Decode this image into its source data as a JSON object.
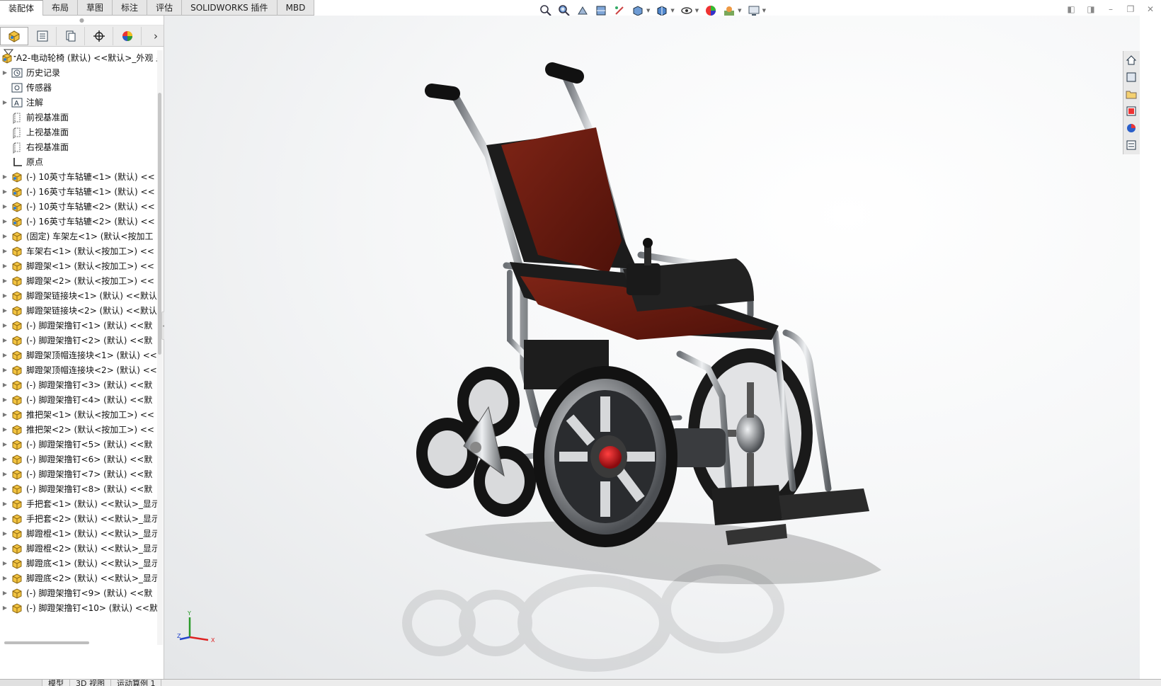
{
  "command_tabs": [
    {
      "label": "装配体"
    },
    {
      "label": "布局"
    },
    {
      "label": "草图"
    },
    {
      "label": "标注"
    },
    {
      "label": "评估"
    },
    {
      "label": "SOLIDWORKS 插件"
    },
    {
      "label": "MBD"
    }
  ],
  "view_toolbar": {
    "icons": [
      "zoom-to-fit-icon",
      "zoom-to-area-icon",
      "previous-view-icon",
      "section-view-icon",
      "dynamic-annotation-icon",
      "view-orientation-icon",
      "display-style-icon",
      "hide-show-items-icon",
      "edit-appearance-icon",
      "apply-scene-icon",
      "view-settings-icon"
    ]
  },
  "feature_tree": {
    "root_label": "A2-电动轮椅 (默认) <<默认>_外观 显",
    "items": [
      {
        "label": "历史记录",
        "icon": "history-icon",
        "expandable": true
      },
      {
        "label": "传感器",
        "icon": "sensor-icon",
        "expandable": false
      },
      {
        "label": "注解",
        "icon": "annotation-icon",
        "expandable": true
      },
      {
        "label": "前视基准面",
        "icon": "plane-icon",
        "expandable": false
      },
      {
        "label": "上视基准面",
        "icon": "plane-icon",
        "expandable": false
      },
      {
        "label": "右视基准面",
        "icon": "plane-icon",
        "expandable": false
      },
      {
        "label": "原点",
        "icon": "origin-icon",
        "expandable": false
      },
      {
        "label": "(-) 10英寸车轱辘<1> (默认) <<",
        "icon": "subassembly-icon",
        "expandable": true
      },
      {
        "label": "(-) 16英寸车轱辘<1> (默认) <<",
        "icon": "subassembly-icon",
        "expandable": true
      },
      {
        "label": "(-) 10英寸车轱辘<2> (默认) <<",
        "icon": "subassembly-icon",
        "expandable": true
      },
      {
        "label": "(-) 16英寸车轱辘<2> (默认) <<",
        "icon": "subassembly-icon",
        "expandable": true
      },
      {
        "label": "(固定) 车架左<1> (默认<按加工",
        "icon": "part-icon",
        "expandable": true
      },
      {
        "label": "车架右<1> (默认<按加工>) <<",
        "icon": "part-icon",
        "expandable": true
      },
      {
        "label": "脚蹬架<1> (默认<按加工>) <<",
        "icon": "part-icon",
        "expandable": true
      },
      {
        "label": "脚蹬架<2> (默认<按加工>) <<",
        "icon": "part-icon",
        "expandable": true
      },
      {
        "label": "脚蹬架链接块<1> (默认) <<默认",
        "icon": "part-icon",
        "expandable": true
      },
      {
        "label": "脚蹬架链接块<2> (默认) <<默认",
        "icon": "part-icon",
        "expandable": true
      },
      {
        "label": "(-) 脚蹬架撸钉<1> (默认) <<默",
        "icon": "part-icon",
        "expandable": true
      },
      {
        "label": "(-) 脚蹬架撸钉<2> (默认) <<默",
        "icon": "part-icon",
        "expandable": true
      },
      {
        "label": "脚蹬架顶帽连接块<1> (默认) <<",
        "icon": "part-icon",
        "expandable": true
      },
      {
        "label": "脚蹬架顶帽连接块<2> (默认) <<",
        "icon": "part-icon",
        "expandable": true
      },
      {
        "label": "(-) 脚蹬架撸钉<3> (默认) <<默",
        "icon": "part-icon",
        "expandable": true
      },
      {
        "label": "(-) 脚蹬架撸钉<4> (默认) <<默",
        "icon": "part-icon",
        "expandable": true
      },
      {
        "label": "推把架<1> (默认<按加工>) <<",
        "icon": "part-icon",
        "expandable": true
      },
      {
        "label": "推把架<2> (默认<按加工>) <<",
        "icon": "part-icon",
        "expandable": true
      },
      {
        "label": "(-) 脚蹬架撸钉<5> (默认) <<默",
        "icon": "part-icon",
        "expandable": true
      },
      {
        "label": "(-) 脚蹬架撸钉<6> (默认) <<默",
        "icon": "part-icon",
        "expandable": true
      },
      {
        "label": "(-) 脚蹬架撸钉<7> (默认) <<默",
        "icon": "part-icon",
        "expandable": true
      },
      {
        "label": "(-) 脚蹬架撸钉<8> (默认) <<默",
        "icon": "part-icon",
        "expandable": true
      },
      {
        "label": "手把套<1> (默认) <<默认>_显示",
        "icon": "part-icon",
        "expandable": true
      },
      {
        "label": "手把套<2> (默认) <<默认>_显示",
        "icon": "part-icon",
        "expandable": true
      },
      {
        "label": "脚蹬棍<1> (默认) <<默认>_显示",
        "icon": "part-icon",
        "expandable": true
      },
      {
        "label": "脚蹬棍<2> (默认) <<默认>_显示",
        "icon": "part-icon",
        "expandable": true
      },
      {
        "label": "脚蹬底<1> (默认) <<默认>_显示",
        "icon": "part-icon",
        "expandable": true
      },
      {
        "label": "脚蹬底<2> (默认) <<默认>_显示",
        "icon": "part-icon",
        "expandable": true
      },
      {
        "label": "(-) 脚蹬架撸钉<9> (默认) <<默",
        "icon": "part-icon",
        "expandable": true
      },
      {
        "label": "(-) 脚蹬架撸钉<10> (默认) <<默",
        "icon": "part-icon",
        "expandable": true
      }
    ]
  },
  "bottom_tabs": [
    {
      "label": "模型"
    },
    {
      "label": "3D 视图"
    },
    {
      "label": "运动算例 1"
    }
  ],
  "triad": {
    "x_label": "X",
    "y_label": "Y",
    "z_label": "Z"
  },
  "colors": {
    "seat_fabric": "#6b1a10",
    "frame_black": "#1c1c1c",
    "chrome": "#b8bcc0",
    "hub_red": "#c8141c"
  }
}
